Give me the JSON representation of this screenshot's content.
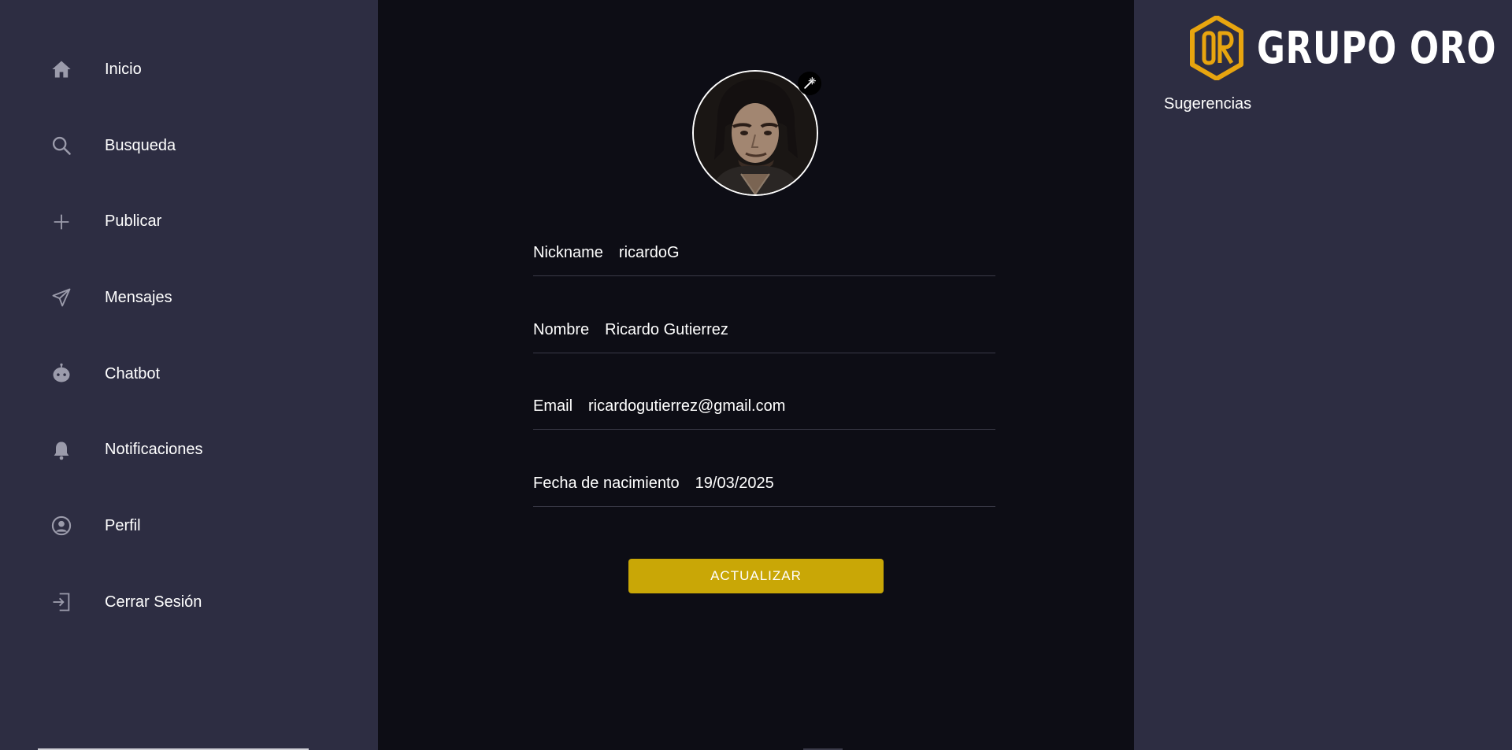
{
  "sidebar": {
    "items": [
      {
        "label": "Inicio",
        "icon": "home-icon"
      },
      {
        "label": "Busqueda",
        "icon": "search-icon"
      },
      {
        "label": "Publicar",
        "icon": "plus-icon"
      },
      {
        "label": "Mensajes",
        "icon": "send-icon"
      },
      {
        "label": "Chatbot",
        "icon": "robot-icon"
      },
      {
        "label": "Notificaciones",
        "icon": "bell-icon"
      },
      {
        "label": "Perfil",
        "icon": "user-circle-icon"
      },
      {
        "label": "Cerrar Sesión",
        "icon": "logout-icon"
      }
    ]
  },
  "profile": {
    "avatar_alt": "Foto de perfil",
    "fields": [
      {
        "label": "Nickname",
        "value": "ricardoG"
      },
      {
        "label": "Nombre",
        "value": "Ricardo Gutierrez"
      },
      {
        "label": "Email",
        "value": "ricardogutierrez@gmail.com"
      },
      {
        "label": "Fecha de nacimiento",
        "value": "19/03/2025"
      }
    ],
    "update_label": "ACTUALIZAR"
  },
  "right_panel": {
    "brand": "GRUPO ORO",
    "suggestions_title": "Sugerencias"
  },
  "colors": {
    "sidebar_bg": "#2d2d42",
    "main_bg": "#0d0d15",
    "accent": "#c9a706",
    "brand_gold": "#e8a50f"
  }
}
